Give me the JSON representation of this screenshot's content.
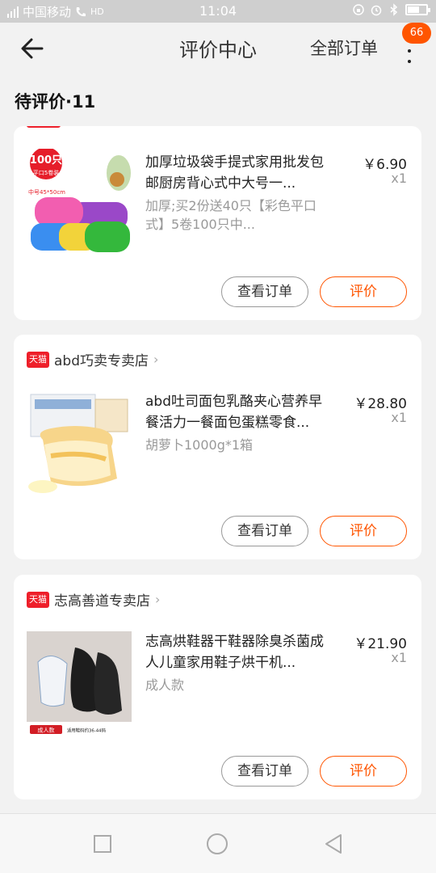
{
  "status_bar": {
    "carrier": "中国移动",
    "network": "4G",
    "hd": "HD",
    "time": "11:04"
  },
  "header": {
    "title": "评价中心",
    "all_orders": "全部订单",
    "badge_count": "66"
  },
  "section": {
    "title": "待评价·11"
  },
  "orders": [
    {
      "store": "",
      "product_title": "加厚垃圾袋手提式家用批发包邮厨房背心式中大号一...",
      "spec": "加厚;买2份送40只【彩色平口式】5卷100只中...",
      "price": "￥6.90",
      "qty": "x1",
      "image_texts": {
        "badge": "100只",
        "badge_sub": "平口5卷装",
        "size": "中号45*50cm"
      },
      "view_label": "查看订单",
      "review_label": "评价"
    },
    {
      "store": "abd巧卖专卖店",
      "store_tag": "天猫",
      "product_title": "abd吐司面包乳酪夹心营养早餐活力一餐面包蛋糕零食...",
      "spec": "胡萝卜1000g*1箱",
      "price": "￥28.80",
      "qty": "x1",
      "view_label": "查看订单",
      "review_label": "评价"
    },
    {
      "store": "志高善道专卖店",
      "store_tag": "天猫",
      "product_title": "志高烘鞋器干鞋器除臭杀菌成人儿童家用鞋子烘干机...",
      "spec": "成人款",
      "price": "￥21.90",
      "qty": "x1",
      "image_texts": {
        "tag": "成人款",
        "caption": "适用鞋码约36-44码"
      },
      "view_label": "查看订单",
      "review_label": "评价"
    }
  ],
  "colors": {
    "accent": "#ff5500",
    "tmall_red": "#ee1f2a",
    "background": "#f2f2f2"
  },
  "icons": {
    "back": "arrow-left-icon",
    "more": "more-vertical-icon",
    "nav_recent": "square-icon",
    "nav_home": "circle-icon",
    "nav_back": "triangle-left-icon"
  }
}
